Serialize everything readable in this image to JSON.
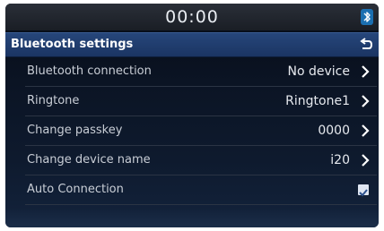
{
  "status_bar": {
    "time": "00:00",
    "bluetooth_icon": "bluetooth-status-icon"
  },
  "header": {
    "title": "Bluetooth settings",
    "back_icon": "back-arrow-icon"
  },
  "settings": [
    {
      "label": "Bluetooth connection",
      "value": "No device"
    },
    {
      "label": "Ringtone",
      "value": "Ringtone1"
    },
    {
      "label": "Change passkey",
      "value": "0000"
    },
    {
      "label": "Change device name",
      "value": "i20"
    }
  ],
  "auto_connection": {
    "label": "Auto Connection",
    "checked": true
  },
  "colors": {
    "title_bar": "#1f3d6e",
    "background": "#0b1424",
    "text": "#c9ced6"
  }
}
